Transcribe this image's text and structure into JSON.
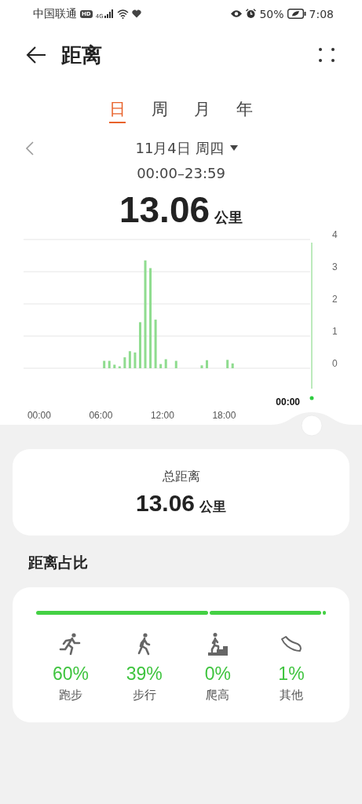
{
  "status_bar": {
    "carrier": "中国联通",
    "hd": "HD",
    "network": "4G",
    "battery": "50%",
    "time": "7:08"
  },
  "header": {
    "title": "距离"
  },
  "tabs": [
    {
      "label": "日",
      "selected": true
    },
    {
      "label": "周",
      "selected": false
    },
    {
      "label": "月",
      "selected": false
    },
    {
      "label": "年",
      "selected": false
    }
  ],
  "date": "11月4日 周四",
  "time_range": "00:00–23:59",
  "total": {
    "value": "13.06",
    "unit": "公里"
  },
  "chart": {
    "cursor_label": "00:00",
    "chart_data": {
      "type": "bar",
      "x": [
        6.25,
        6.75,
        7.25,
        7.75,
        8.25,
        8.75,
        9.25,
        9.75,
        10.25,
        10.75,
        11.25,
        11.75,
        12.25,
        13.25,
        15.75,
        16.25,
        18.25,
        18.75
      ],
      "values": [
        0.23,
        0.23,
        0.11,
        0.06,
        0.34,
        0.53,
        0.49,
        1.43,
        3.35,
        3.11,
        1.51,
        0.13,
        0.28,
        0.23,
        0.09,
        0.25,
        0.26,
        0.15
      ],
      "xticks": [
        {
          "value": 0,
          "label": "00:00"
        },
        {
          "value": 6,
          "label": "06:00"
        },
        {
          "value": 12,
          "label": "12:00"
        },
        {
          "value": 18,
          "label": "18:00"
        }
      ],
      "yticks": [
        0,
        1,
        2,
        3,
        4
      ],
      "xlim": [
        -1.6,
        26.3
      ],
      "ylim": [
        0,
        4
      ],
      "grid": true
    }
  },
  "summary": {
    "label": "总距离",
    "value": "13.06",
    "unit": "公里"
  },
  "section_title": "距离占比",
  "breakdown": [
    {
      "kind": "run",
      "share": "60%",
      "label": "跑步"
    },
    {
      "kind": "walk",
      "share": "39%",
      "label": "步行"
    },
    {
      "kind": "climb",
      "share": "0%",
      "label": "爬高"
    },
    {
      "kind": "other",
      "share": "1%",
      "label": "其他"
    }
  ]
}
